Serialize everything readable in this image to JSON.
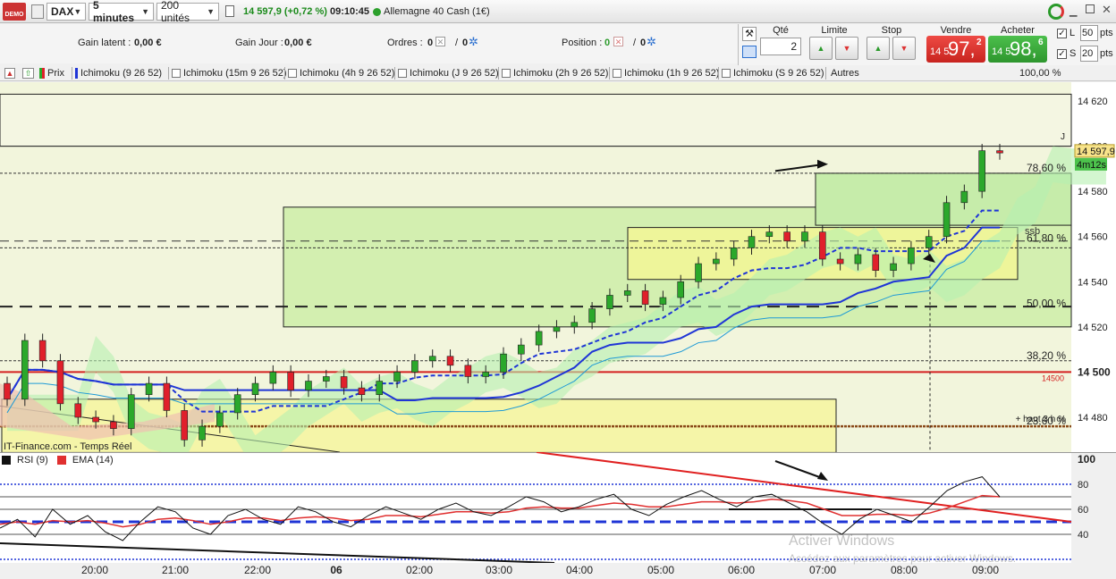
{
  "toolbar": {
    "demo_badge": "DEMO",
    "instrument": "DAX",
    "timeframe": "5 minutes",
    "units": "200 unités",
    "last_price": "14 597,9",
    "change": "(+0,72 %)",
    "time": "09:10:45",
    "market_name": "Allemagne 40 Cash (1€)"
  },
  "info": {
    "gain_latent_label": "Gain latent :",
    "gain_latent_value": "0,00 €",
    "gain_jour_label": "Gain Jour :",
    "gain_jour_value": "0,00 €",
    "ordres_label": "Ordres :",
    "ordres_value": "0",
    "ordres_sep": "/",
    "ordres_value2": "0",
    "position_label": "Position :",
    "position_value": "0",
    "position_sep": "/",
    "position_value2": "0"
  },
  "order_panel": {
    "qty_label": "Qté",
    "qty_value": "2",
    "limit_label": "Limite",
    "stop_label": "Stop",
    "sell_label": "Vendre",
    "buy_label": "Acheter",
    "sell_small": "14 5",
    "sell_big": "97,",
    "sell_sup": "2",
    "buy_small": "14 5",
    "buy_big": "98,",
    "buy_sup": "6",
    "l_label": "L",
    "l_value": "50",
    "s_label": "S",
    "s_value": "20",
    "pts": "pts",
    "sell_color": "#d9302c",
    "buy_color": "#3aa53a"
  },
  "legend": {
    "items": [
      "Prix",
      "Ichimoku (9 26 52)",
      "Ichimoku (15m 9 26 52)",
      "Ichimoku (4h 9 26 52)",
      "Ichimoku (J 9 26 52)",
      "Ichimoku (2h 9 26 52)",
      "Ichimoku (1h 9 26 52)",
      "Ichimoku (S 9 26 52)",
      "Autres"
    ],
    "zoom": "100,00 %"
  },
  "chart_data": [
    {
      "type": "candlestick",
      "title": "",
      "source_label": "IT-Finance.com - Temps Réel",
      "y_ticks": [
        "14 620",
        "14 600",
        "14 580",
        "14 560",
        "14 540",
        "14 520",
        "14 500",
        "14 480"
      ],
      "ylim": [
        14465,
        14630
      ],
      "x_ticks": [
        "20:00",
        "21:00",
        "22:00",
        "06",
        "02:00",
        "03:00",
        "04:00",
        "05:00",
        "06:00",
        "07:00",
        "08:00",
        "09:00"
      ],
      "fib_labels": [
        "78,60 %",
        "61,80 %",
        "50,00 %",
        "38,20 %",
        "23,60 %"
      ],
      "fib_levels": [
        14588,
        14557,
        14528,
        14505,
        14476
      ],
      "level_14500_label": "14500",
      "ssb_label": "ssb",
      "j_label": "J",
      "haut_label": "+ haut 3 h %",
      "current_price_label": "14 597,9",
      "countdown_label": "4m12s",
      "current_price": 14597.9,
      "closes_approx": [
        14488,
        14514,
        14505,
        14486,
        14480,
        14478,
        14475,
        14490,
        14495,
        14483,
        14470,
        14476,
        14482,
        14490,
        14495,
        14500,
        14492,
        14496,
        14498,
        14493,
        14490,
        14496,
        14500,
        14505,
        14507,
        14503,
        14498,
        14500,
        14508,
        14512,
        14518,
        14520,
        14522,
        14528,
        14534,
        14536,
        14530,
        14533,
        14540,
        14548,
        14550,
        14555,
        14560,
        14562,
        14558,
        14562,
        14550,
        14548,
        14552,
        14545,
        14548,
        14555,
        14560,
        14575,
        14580,
        14598,
        14597
      ],
      "colors": {
        "up": "#2ba82b",
        "down": "#e0202b",
        "tenkan": "#1f35d6",
        "kijun": "#1f35d6",
        "cloud_green": "#b6f0b0",
        "cloud_red": "#f0c0b0",
        "level_red": "#d42020"
      }
    },
    {
      "type": "line",
      "title": "",
      "series": [
        {
          "name": "RSI (9)",
          "color": "#111111"
        },
        {
          "name": "EMA (14)",
          "color": "#e03030"
        }
      ],
      "y_ticks": [
        "100",
        "80",
        "60",
        "40"
      ],
      "ylim": [
        20,
        100
      ],
      "rsi_values": [
        45,
        52,
        38,
        60,
        48,
        55,
        42,
        35,
        50,
        62,
        58,
        45,
        40,
        55,
        60,
        52,
        48,
        62,
        58,
        50,
        46,
        55,
        62,
        57,
        52,
        60,
        65,
        58,
        55,
        62,
        70,
        66,
        58,
        62,
        68,
        72,
        60,
        55,
        64,
        70,
        75,
        68,
        62,
        70,
        72,
        65,
        58,
        48,
        40,
        52,
        60,
        55,
        50,
        62,
        75,
        82,
        86,
        70
      ],
      "ema_values": [
        48,
        50,
        48,
        51,
        50,
        51,
        49,
        46,
        48,
        52,
        53,
        51,
        48,
        50,
        53,
        53,
        51,
        53,
        54,
        53,
        51,
        52,
        55,
        55,
        54,
        56,
        58,
        58,
        57,
        58,
        61,
        62,
        61,
        61,
        63,
        65,
        64,
        62,
        62,
        64,
        66,
        66,
        65,
        66,
        68,
        67,
        65,
        60,
        55,
        55,
        56,
        56,
        55,
        57,
        61,
        66,
        71,
        70
      ]
    }
  ],
  "watermark": {
    "line1": "Activer Windows",
    "line2": "Accédez aux paramètres pour activer Windows."
  }
}
